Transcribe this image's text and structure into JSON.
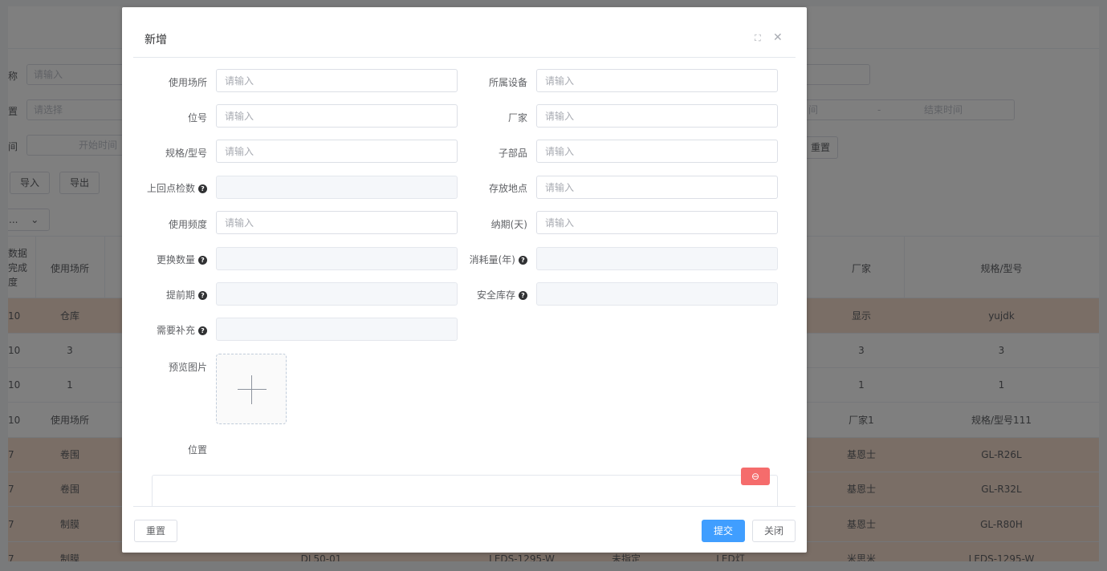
{
  "background": {
    "filters": [
      {
        "label": "称",
        "placeholder": "请输入"
      },
      {
        "label": "置",
        "placeholder": "请选择"
      },
      {
        "label": "间",
        "start_placeholder": "开始时间"
      }
    ],
    "right_filters": {
      "range_start": "间",
      "range_separator": "-",
      "range_end": "结束时间",
      "reset_label": "重置"
    },
    "toolbar": {
      "import_label": "导入",
      "export_label": "导出"
    },
    "select_label": "...",
    "table": {
      "headers": {
        "col0": "数据\n完成\n度",
        "usage_place": "使用场所",
        "manufacturer": "厂家",
        "spec": "规格/型号"
      },
      "rows": [
        {
          "c0": "10",
          "usage_place": "仓库",
          "manufacturer": "显示",
          "spec": "yujdk",
          "highlight": true
        },
        {
          "c0": "10",
          "usage_place": "3",
          "manufacturer": "3",
          "spec": "3",
          "highlight": false
        },
        {
          "c0": "10",
          "usage_place": "1",
          "manufacturer": "1",
          "spec": "1",
          "highlight": false
        },
        {
          "c0": "10",
          "usage_place": "使用场所",
          "manufacturer": "厂家1",
          "spec": "规格/型号111",
          "highlight": false
        },
        {
          "c0": "7",
          "usage_place": "卷围",
          "manufacturer": "基恩士",
          "spec": "GL-R26L",
          "highlight": true
        },
        {
          "c0": "7",
          "usage_place": "卷围",
          "manufacturer": "基恩士",
          "spec": "GL-R32L",
          "highlight": true
        },
        {
          "c0": "7",
          "usage_place": "制膜",
          "manufacturer": "基恩士",
          "spec": "GL-R80H",
          "highlight": true
        },
        {
          "c0": "7",
          "usage_place": "制膜",
          "extra1": "DL50-01",
          "extra2": "LEDS-1295-W",
          "extra3": "未指定",
          "extra4": "LED灯",
          "manufacturer": "米思米",
          "spec": "LEDS-1295-W",
          "highlight": true
        }
      ]
    }
  },
  "dialog": {
    "title": "新增",
    "fields": {
      "usage_place": {
        "label": "使用场所",
        "placeholder": "请输入"
      },
      "device": {
        "label": "所属设备",
        "placeholder": "请输入"
      },
      "position_no": {
        "label": "位号",
        "placeholder": "请输入"
      },
      "manufacturer": {
        "label": "厂家",
        "placeholder": "请输入"
      },
      "spec": {
        "label": "规格/型号",
        "placeholder": "请输入"
      },
      "sub_part": {
        "label": "子部品",
        "placeholder": "请输入"
      },
      "last_inspection": {
        "label": "上回点检数"
      },
      "storage": {
        "label": "存放地点",
        "placeholder": "请输入"
      },
      "frequency": {
        "label": "使用频度",
        "placeholder": "请输入"
      },
      "lead_days": {
        "label": "纳期(天)",
        "placeholder": "请输入"
      },
      "replace_qty": {
        "label": "更换数量"
      },
      "annual_consumption": {
        "label": "消耗量(年)"
      },
      "advance_period": {
        "label": "提前期"
      },
      "safety_stock": {
        "label": "安全库存"
      },
      "need_restock": {
        "label": "需要补充"
      },
      "preview_image": {
        "label": "预览图片"
      },
      "location": {
        "label": "位置"
      }
    },
    "footer": {
      "reset_label": "重置",
      "submit_label": "提交",
      "close_label": "关闭"
    }
  },
  "colors": {
    "primary": "#409eff",
    "danger": "#f56c6c",
    "row_highlight": "#f5dccc"
  }
}
